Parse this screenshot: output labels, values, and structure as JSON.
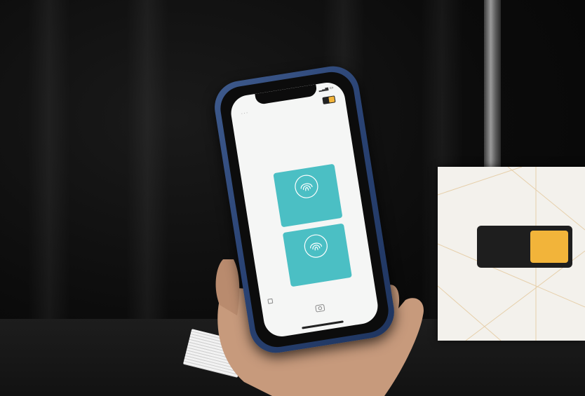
{
  "phone": {
    "status_time": "",
    "title": "",
    "subtitle": "",
    "options": [
      {
        "label": "",
        "icon": "fingerprint-icon"
      },
      {
        "label": "",
        "icon": "fingerprint-icon"
      }
    ],
    "footnote": ""
  },
  "sign": {
    "logo_text": "",
    "caption": ""
  },
  "colors": {
    "phone_case": "#2a4374",
    "tile": "#4bbfc4",
    "brand_yellow": "#f2b43a"
  }
}
